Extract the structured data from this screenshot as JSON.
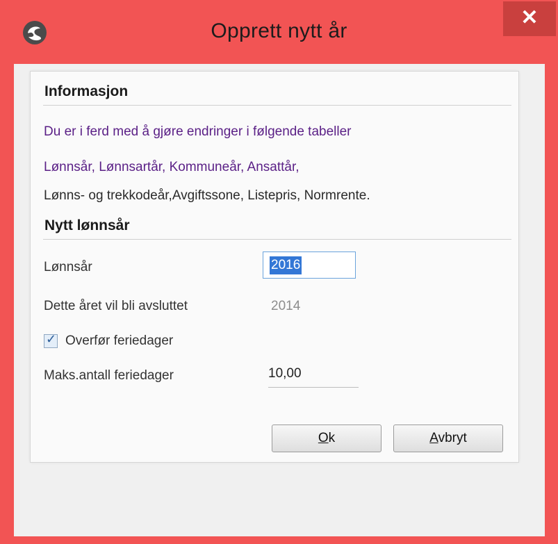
{
  "window": {
    "title": "Opprett nytt år",
    "close_label": "✕"
  },
  "info": {
    "heading": "Informasjon",
    "line1": "Du er i ferd med å gjøre endringer i følgende tabeller",
    "line2": "Lønnsår, Lønnsartår, Kommuneår, Ansattår,",
    "line3": "Lønns- og trekkodeår,Avgiftssone, Listepris, Normrente."
  },
  "year": {
    "heading": "Nytt lønnsår",
    "lonnsar_label": "Lønnsår",
    "lonnsar_value": "2016",
    "closed_label": "Dette året vil bli avsluttet",
    "closed_value": "2014",
    "transfer_label": "Overfør feriedager",
    "transfer_checked": true,
    "max_label": "Maks.antall feriedager",
    "max_value": "10,00"
  },
  "buttons": {
    "ok_label": "Ok",
    "cancel_label": "Avbryt"
  },
  "colors": {
    "frame": "#f25454",
    "close": "#c9403e",
    "accent_text": "#5a1f86",
    "selection": "#3377d6"
  },
  "icons": {
    "app": "app-logo-icon",
    "close": "close-icon",
    "checkmark": "checkmark-icon"
  }
}
